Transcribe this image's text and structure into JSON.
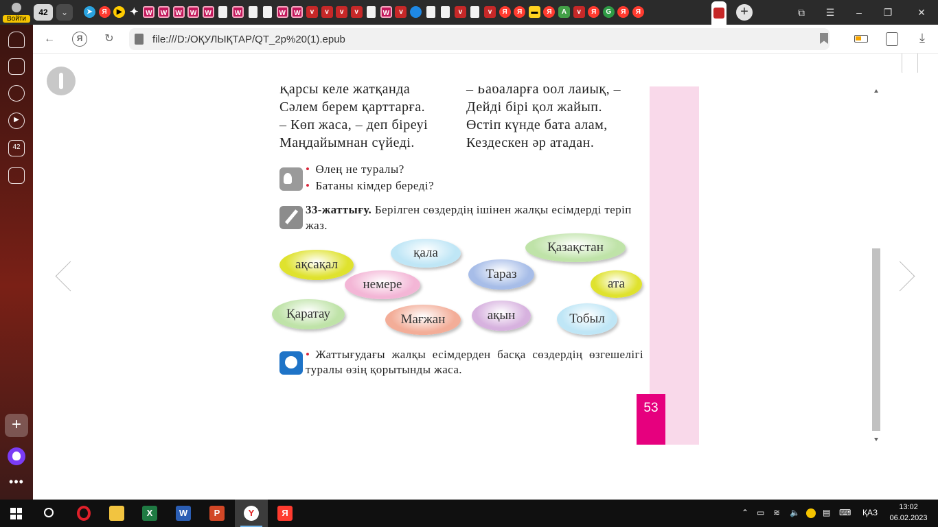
{
  "browser": {
    "profile_label": "Войти",
    "tab_count": "42",
    "tab_icons": [
      "telegram",
      "yandex",
      "youtube",
      "star",
      "book",
      "book",
      "book",
      "book",
      "book",
      "page",
      "book",
      "page",
      "page",
      "book",
      "book",
      "pdf",
      "pdf",
      "pdf",
      "pdf",
      "page",
      "book",
      "pdf",
      "globe",
      "page",
      "page",
      "pdf",
      "page",
      "pdf",
      "yandex",
      "yandex",
      "ads",
      "yandex",
      "alice-a",
      "pdf",
      "yandex",
      "green-g",
      "yandex",
      "yandex"
    ],
    "address": "file:///D:/ОҚУЛЫҚТАР/QT_2p%20(1).epub",
    "sidebar_badge": "42"
  },
  "page": {
    "poem_left": [
      "Қарсы келе жатқанда",
      "Сәлем берем қарттарға.",
      "– Көп жаса, – деп біреуі",
      "Маңдайымнан сүйеді."
    ],
    "poem_right": [
      "– Бабаларға бол лайық, –",
      "Дейді бірі қол жайып.",
      "Өстіп күнде бата алам,",
      "Кездескен әр атадан."
    ],
    "questions": [
      "Өлең не туралы?",
      "Батаны кімдер береді?"
    ],
    "task_number": "33-жаттығу.",
    "task_text": "Берілген сөздердің ішінен жалқы есімдерді теріп жаз.",
    "words": [
      {
        "text": "ақсақал",
        "color": "#dfe22e"
      },
      {
        "text": "қала",
        "color": "#bfe6f6"
      },
      {
        "text": "немере",
        "color": "#f3b6d6"
      },
      {
        "text": "Тараз",
        "color": "#a7bde8"
      },
      {
        "text": "Қазақстан",
        "color": "#bfe3a8"
      },
      {
        "text": "ата",
        "color": "#dfe22e"
      },
      {
        "text": "Қаратау",
        "color": "#bfe3a8"
      },
      {
        "text": "Мағжан",
        "color": "#f3ad98"
      },
      {
        "text": "ақын",
        "color": "#d7b2df"
      },
      {
        "text": "Тобыл",
        "color": "#bfe6f6"
      }
    ],
    "discussion": "Жаттығудағы жалқы есімдерден басқа сөздердің өзгешелігі туралы өзің қорытынды жаса.",
    "page_number": "53"
  },
  "taskbar": {
    "language": "ҚАЗ",
    "time": "13:02",
    "date": "06.02.2023",
    "apps": [
      "opera",
      "explorer",
      "excel",
      "word",
      "powerpoint",
      "yandex-browser",
      "yandex"
    ]
  }
}
